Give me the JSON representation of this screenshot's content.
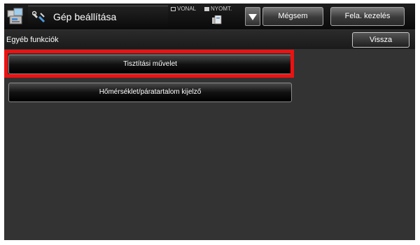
{
  "header": {
    "title": "Gép beállítása",
    "home_icon": "home-icon",
    "title_icon": "settings-icon",
    "mode_line": "VONAL",
    "mode_print": "NYOMT.",
    "job_icon": "job-status-icon",
    "dropdown_icon": "triangle-down-icon",
    "cancel_label": "Mégsem",
    "job_label": "Fela. kezelés"
  },
  "subbar": {
    "title": "Egyéb funkciók",
    "back_label": "Vissza"
  },
  "functions": [
    {
      "label": "Tisztítási művelet",
      "highlighted": true
    },
    {
      "label": "Hőmérséklet/páratartalom kijelző",
      "highlighted": false
    }
  ],
  "colors": {
    "highlight": "#ee1111",
    "background": "#333333"
  }
}
